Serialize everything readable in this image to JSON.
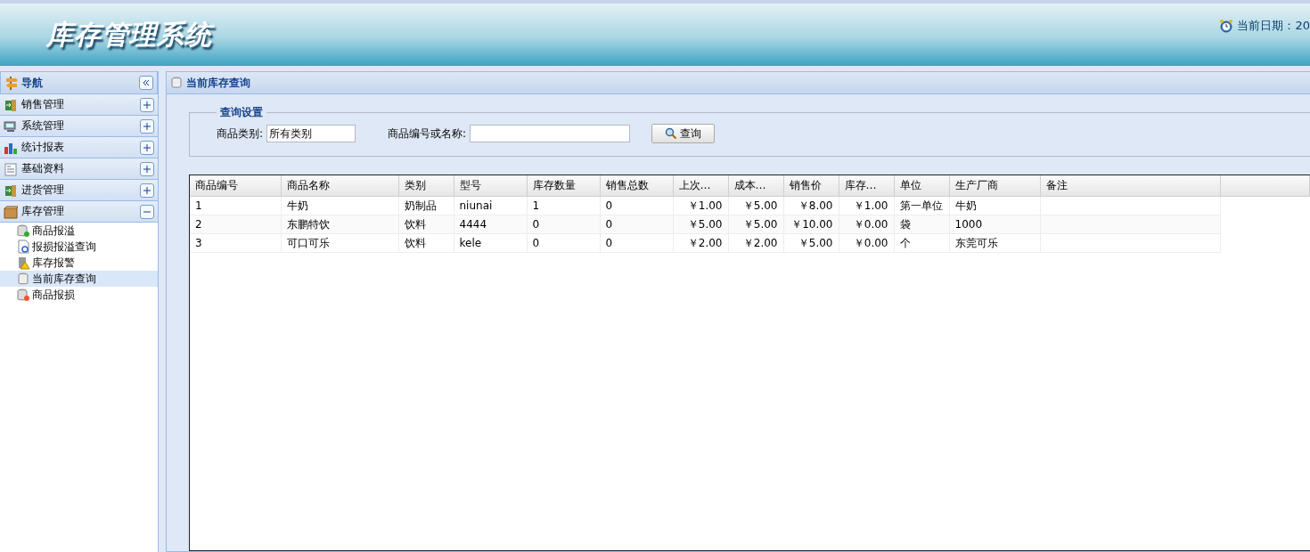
{
  "header": {
    "title": "库存管理系统",
    "date_label": "当前日期：20"
  },
  "nav": {
    "title": "导航",
    "sections": [
      {
        "label": "销售管理",
        "expanded": false
      },
      {
        "label": "系统管理",
        "expanded": false
      },
      {
        "label": "统计报表",
        "expanded": false
      },
      {
        "label": "基础资料",
        "expanded": false
      },
      {
        "label": "进货管理",
        "expanded": false
      },
      {
        "label": "库存管理",
        "expanded": true,
        "children": [
          {
            "label": "商品报溢",
            "selected": false
          },
          {
            "label": "报损报溢查询",
            "selected": false
          },
          {
            "label": "库存报警",
            "selected": false
          },
          {
            "label": "当前库存查询",
            "selected": true
          },
          {
            "label": "商品报损",
            "selected": false
          }
        ]
      }
    ]
  },
  "panel": {
    "title": "当前库存查询",
    "query": {
      "legend": "查询设置",
      "fields": [
        {
          "label": "商品类别:",
          "value": "所有类别"
        },
        {
          "label": "商品编号或名称:"
        }
      ],
      "button": "查询"
    },
    "table": {
      "columns": [
        {
          "label": "商品编号",
          "kind": "text"
        },
        {
          "label": "商品名称",
          "kind": "text"
        },
        {
          "label": "类别",
          "kind": "text"
        },
        {
          "label": "型号",
          "kind": "text"
        },
        {
          "label": "库存数量",
          "kind": "text"
        },
        {
          "label": "销售总数",
          "kind": "text"
        },
        {
          "label": "上次…",
          "kind": "money"
        },
        {
          "label": "成本…",
          "kind": "money"
        },
        {
          "label": "销售价",
          "kind": "money"
        },
        {
          "label": "库存…",
          "kind": "money"
        },
        {
          "label": "单位",
          "kind": "text"
        },
        {
          "label": "生产厂商",
          "kind": "text"
        },
        {
          "label": "备注",
          "kind": "text"
        }
      ],
      "rows": [
        [
          "1",
          "牛奶",
          "奶制品",
          "niunai",
          "1",
          "0",
          "￥1.00",
          "￥5.00",
          "￥8.00",
          "￥1.00",
          "第一单位",
          "牛奶",
          ""
        ],
        [
          "2",
          "东鹏特饮",
          "饮料",
          "4444",
          "0",
          "0",
          "￥5.00",
          "￥5.00",
          "￥10.00",
          "￥0.00",
          "袋",
          "1000",
          ""
        ],
        [
          "3",
          "可口可乐",
          "饮料",
          "kele",
          "0",
          "0",
          "￥2.00",
          "￥2.00",
          "￥5.00",
          "￥0.00",
          "个",
          "东莞可乐",
          ""
        ]
      ]
    }
  }
}
